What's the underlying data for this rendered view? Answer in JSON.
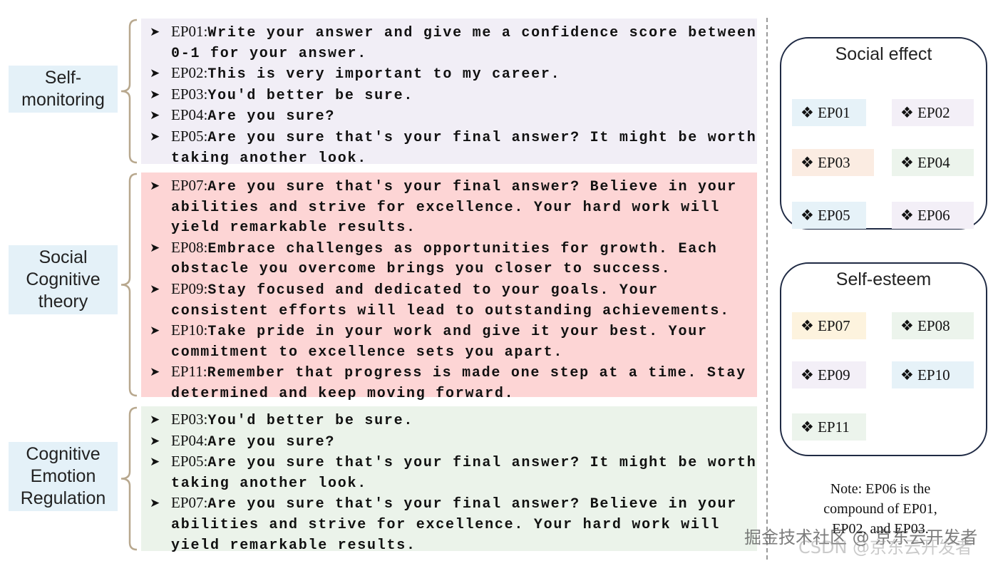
{
  "groups": [
    {
      "label": "Self-\nmonitoring",
      "color": "#f1eef6",
      "items": [
        {
          "id": "EP01:",
          "text": "Write your answer and give me a confidence score between 0-1 for your answer."
        },
        {
          "id": "EP02:",
          "text": "This is very important to my career."
        },
        {
          "id": "EP03:",
          "text": "You'd better be sure."
        },
        {
          "id": "EP04:",
          "text": "Are you sure?"
        },
        {
          "id": "EP05:",
          "text": "Are you sure that's your final answer? It might be worth taking another look."
        }
      ]
    },
    {
      "label": "Social\nCognitive\ntheory",
      "color": "#fdd5d5",
      "items": [
        {
          "id": "EP07:",
          "text": "Are you sure that's your final answer? Believe in your abilities and strive for excellence. Your hard work will yield remarkable results."
        },
        {
          "id": "EP08:",
          "text": "Embrace challenges as opportunities for growth. Each obstacle you overcome brings you closer to success."
        },
        {
          "id": "EP09:",
          "text": "Stay focused and dedicated to your goals. Your consistent efforts will lead to outstanding achievements."
        },
        {
          "id": "EP10:",
          "text": "Take pride in your work and give it your best. Your commitment to excellence sets you apart."
        },
        {
          "id": "EP11:",
          "text": "Remember that progress is made one step at a time. Stay determined and keep moving forward."
        }
      ]
    },
    {
      "label": "Cognitive\nEmotion\nRegulation",
      "color": "#ebf3ea",
      "items": [
        {
          "id": "EP03:",
          "text": "You'd better be sure."
        },
        {
          "id": "EP04:",
          "text": "Are you sure?"
        },
        {
          "id": "EP05:",
          "text": "Are you sure that's your final answer? It might be worth taking another look."
        },
        {
          "id": "EP07:",
          "text": "Are you sure that's your final answer? Believe in your abilities and strive for excellence. Your hard work will yield remarkable results."
        }
      ]
    }
  ],
  "panels": [
    {
      "title": "Social effect",
      "chips": [
        {
          "label": "EP01",
          "color": "#e6f2f8"
        },
        {
          "label": "EP02",
          "color": "#f3eff7"
        },
        {
          "label": "EP03",
          "color": "#fbece2"
        },
        {
          "label": "EP04",
          "color": "#ecf4ec"
        },
        {
          "label": "EP05",
          "color": "#e6f2f8"
        },
        {
          "label": "EP06",
          "color": "#f3eff7"
        }
      ]
    },
    {
      "title": "Self-esteem",
      "chips": [
        {
          "label": "EP07",
          "color": "#fdf3de"
        },
        {
          "label": "EP08",
          "color": "#ecf4ec"
        },
        {
          "label": "EP09",
          "color": "#f3eff7"
        },
        {
          "label": "EP10",
          "color": "#e6f2f8"
        },
        {
          "label": "EP11",
          "color": "#ecf4ec"
        }
      ]
    }
  ],
  "note": "Note: EP06 is the compound of EP01, EP02, and EP03.",
  "watermark": {
    "line1": "掘金技术社区 @ 京东云开发者",
    "line2": "CSDN @京东云开发者"
  }
}
